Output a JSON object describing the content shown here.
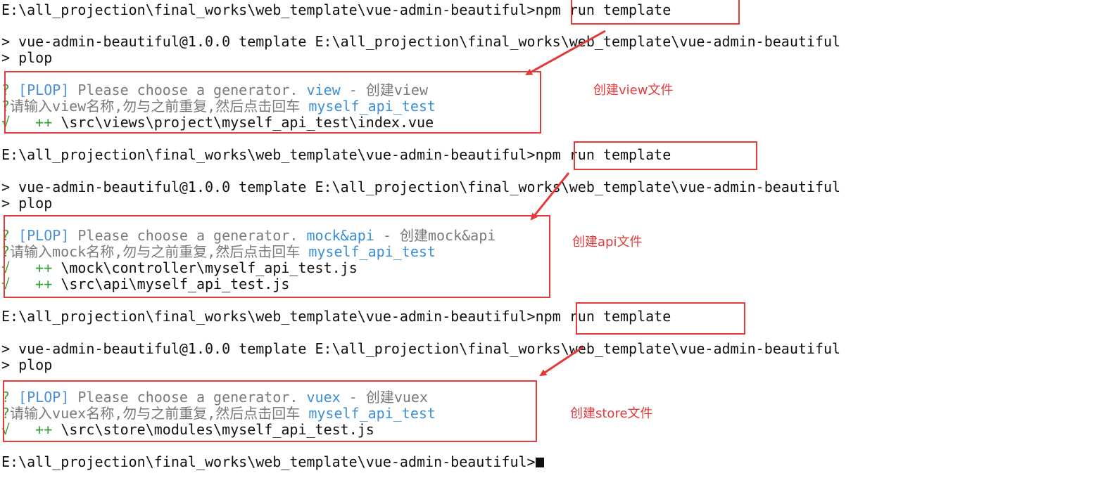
{
  "terminal": {
    "path": "E:\\all_projection\\final_works\\web_template\\vue-admin-beautiful",
    "prompt_suffix": ">",
    "command": "npm run template",
    "npm_echo": "> vue-admin-beautiful@1.0.0 template E:\\all_projection\\final_works\\web_template\\vue-admin-beautiful",
    "plop_echo": "> plop",
    "question_mark": "?",
    "plop_tag": "[PLOP]",
    "choose_text": "Please choose a generator.",
    "name_prompt_suffix": "名称,勿与之前重复,然后点击回车",
    "name_prompt_prefix": "请输入",
    "answer_name": "myself_api_test",
    "check_mark": "√",
    "plus_mark": "++",
    "sessions": [
      {
        "generator": "view",
        "generator_desc": "- 创建view",
        "name_prompt": "请输入view名称,勿与之前重复,然后点击回车",
        "files": [
          "\\src\\views\\project\\myself_api_test\\index.vue"
        ],
        "annotation": "创建view文件"
      },
      {
        "generator": "mock&api",
        "generator_desc": "- 创建mock&api",
        "name_prompt": "请输入mock名称,勿与之前重复,然后点击回车",
        "files": [
          "\\mock\\controller\\myself_api_test.js",
          "\\src\\api\\myself_api_test.js"
        ],
        "annotation": "创建api文件"
      },
      {
        "generator": "vuex",
        "generator_desc": "- 创建vuex",
        "name_prompt": "请输入vuex名称,勿与之前重复,然后点击回车",
        "files": [
          "\\src\\store\\modules\\myself_api_test.js"
        ],
        "annotation": "创建store文件"
      }
    ]
  },
  "colors": {
    "annotation_red": "#e23a3a",
    "plop_blue": "#4a90d9",
    "answer_blue": "#3a8fd6",
    "check_green": "#2fa02f",
    "dim_gray": "#7a7a7a"
  }
}
